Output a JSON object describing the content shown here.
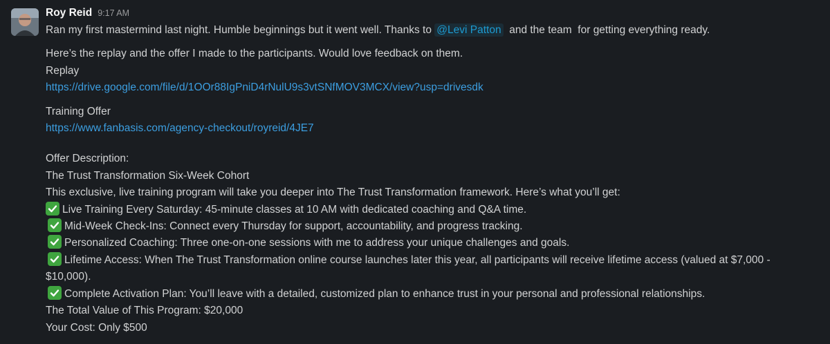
{
  "message": {
    "author": "Roy Reid",
    "time": "9:17 AM",
    "intro_before": "Ran my first mastermind last night. Humble beginnings but it went well. Thanks to",
    "mention": "@Levi Patton",
    "intro_after": "and the team  for getting everything ready.",
    "replay_intro": "Here’s the replay and the offer I made to the participants. Would love feedback on them.",
    "replay_label": "Replay",
    "replay_url": "https://drive.google.com/file/d/1OOr88IgPniD4rNulU9s3vtSNfMOV3MCX/view?usp=drivesdk",
    "offer_label": "Training Offer",
    "offer_url": "https://www.fanbasis.com/agency-checkout/royreid/4JE7",
    "desc_label": "Offer Description:",
    "program_title": "The Trust Transformation Six-Week Cohort",
    "program_intro": "This exclusive, live training program will take you deeper into The Trust Transformation framework. Here’s what you’ll get:",
    "bullets": [
      "Live Training Every Saturday: 45-minute classes at 10 AM with dedicated coaching and Q&A time.",
      "Mid-Week Check-Ins: Connect every Thursday for support, accountability, and progress tracking.",
      "Personalized Coaching: Three one-on-one sessions with me to address your unique challenges and goals.",
      "Lifetime Access: When The Trust Transformation online course launches later this year, all participants will receive lifetime access (valued at $7,000 -",
      "Complete Activation Plan: You’ll leave with a detailed, customized plan to enhance trust in your personal and professional relationships."
    ],
    "bullet_4_cont": "$10,000).",
    "total_value": "The Total Value of This Program: $20,000",
    "your_cost": "Your Cost: Only $500"
  },
  "icons": {
    "bullet": "white-check-mark-icon",
    "avatar": "avatar"
  },
  "colors": {
    "background": "#1a1d21",
    "link": "#3c9ee0",
    "mention": "#1d9bd1",
    "check": "#3fa53f"
  }
}
